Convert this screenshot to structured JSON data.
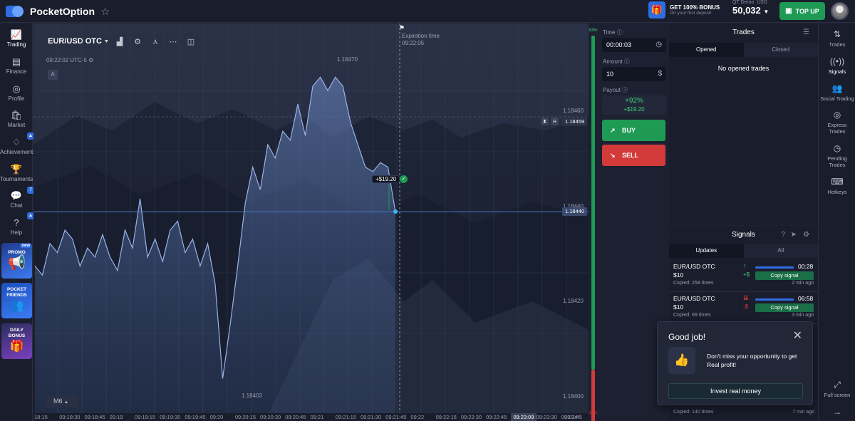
{
  "header": {
    "brand": "PocketOption",
    "bonus_title": "GET 100% BONUS",
    "bonus_sub": "On your first deposit",
    "account_type": "QT Demo",
    "currency": "USD",
    "balance": "50,032",
    "topup_label": "TOP UP"
  },
  "left_nav": [
    {
      "label": "Trading",
      "icon": "chart-line-icon"
    },
    {
      "label": "Finance",
      "icon": "wallet-icon"
    },
    {
      "label": "Profile",
      "icon": "user-icon"
    },
    {
      "label": "Market",
      "icon": "cart-icon"
    },
    {
      "label": "Achievements",
      "icon": "diamond-icon"
    },
    {
      "label": "Tournaments",
      "icon": "trophy-icon"
    },
    {
      "label": "Chat",
      "icon": "chat-icon",
      "badge": "7"
    },
    {
      "label": "Help",
      "icon": "help-icon"
    }
  ],
  "promos": {
    "promo": "PROMO",
    "promo_badge": "new",
    "friends": "POCKET FRIENDS",
    "daily": "DAILY BONUS"
  },
  "chart": {
    "asset": "EUR/USD OTC",
    "server_time": "09:22:02 UTC-5",
    "expiration_label": "Expiration time",
    "expiration_time": "09:22:05",
    "timeframe": "M6",
    "profit_tag": "+$19.20",
    "price_labels": [
      "1.18470",
      "1.18460",
      "1.18440",
      "1.18420",
      "1.18403",
      "1.18400"
    ],
    "marker_price": "1.18459",
    "current_price": "1.18440",
    "x_ticks": [
      "18:15",
      "09:18:30",
      "09:18:45",
      "09:19",
      "09:19:15",
      "09:19:30",
      "09:19:45",
      "09:20",
      "09:20:15",
      "09:20:30",
      "09:20:45",
      "09:21",
      "09:21:15",
      "09:21:30",
      "09:21:45",
      "09:22",
      "09:22:15",
      "09:22:30",
      "09:22:45",
      "09:23:09",
      "09:23:30",
      "09:23:45",
      "09:24"
    ],
    "sentiment_up": "83%",
    "sentiment_down": "17%"
  },
  "trade_panel": {
    "time_label": "Time",
    "time_value": "00:00:03",
    "amount_label": "Amount",
    "amount_value": "10",
    "payout_label": "Payout",
    "payout_pct": "+92%",
    "payout_amt": "+$19.20",
    "buy_label": "BUY",
    "sell_label": "SELL"
  },
  "trades": {
    "title": "Trades",
    "tab_opened": "Opened",
    "tab_closed": "Closed",
    "empty": "No opened trades"
  },
  "signals": {
    "title": "Signals",
    "tab_updates": "Updates",
    "tab_all": "All",
    "items": [
      {
        "pair": "EUR/USD OTC",
        "amount": "$10",
        "copied": "Copied: 258 times",
        "sign": "+$",
        "time": "00:28",
        "btn": "Copy signal",
        "ago": "2 min ago",
        "dir": "up"
      },
      {
        "pair": "EUR/USD OTC",
        "amount": "$10",
        "copied": "Copied: 69 times",
        "sign": "-$",
        "time": "06:58",
        "btn": "Copy signal",
        "ago": "3 min ago",
        "dir": "down"
      }
    ],
    "bottom_copied": "Copied: 140 times",
    "bottom_ago": "7 min ago"
  },
  "right_nav": [
    {
      "label": "Trades",
      "icon": "arrows-icon"
    },
    {
      "label": "Signals",
      "icon": "broadcast-icon"
    },
    {
      "label": "Social Trading",
      "icon": "users-icon"
    },
    {
      "label": "Express Trades",
      "icon": "target-icon"
    },
    {
      "label": "Pending Trades",
      "icon": "clock-icon"
    },
    {
      "label": "Hotkeys",
      "icon": "keyboard-icon"
    },
    {
      "label": "Full screen",
      "icon": "expand-icon"
    }
  ],
  "toast": {
    "title": "Good job!",
    "message": "Don't miss your opportunity to get Real profit!",
    "button": "Invest real money"
  },
  "colors": {
    "buy": "#1f9a55",
    "sell": "#d33a3a",
    "accent": "#2f6de1"
  },
  "chart_data": {
    "type": "area",
    "series": [
      {
        "values": [
          1.18428,
          1.18426,
          1.18433,
          1.18431,
          1.18436,
          1.18434,
          1.18428,
          1.18432,
          1.1843,
          1.18435,
          1.1843,
          1.18427,
          1.18436,
          1.18432,
          1.18443,
          1.1843,
          1.18434,
          1.18429,
          1.18436,
          1.18438,
          1.18431,
          1.18434,
          1.18428,
          1.18433,
          1.18424,
          1.18403,
          1.18415,
          1.18428,
          1.18442,
          1.1845,
          1.18445,
          1.18455,
          1.18452,
          1.18458,
          1.18456,
          1.18464,
          1.18457,
          1.18468,
          1.1847,
          1.18467,
          1.1847,
          1.18468,
          1.1846,
          1.18455,
          1.1845,
          1.18449,
          1.18451,
          1.1845,
          1.1844
        ]
      }
    ]
  }
}
